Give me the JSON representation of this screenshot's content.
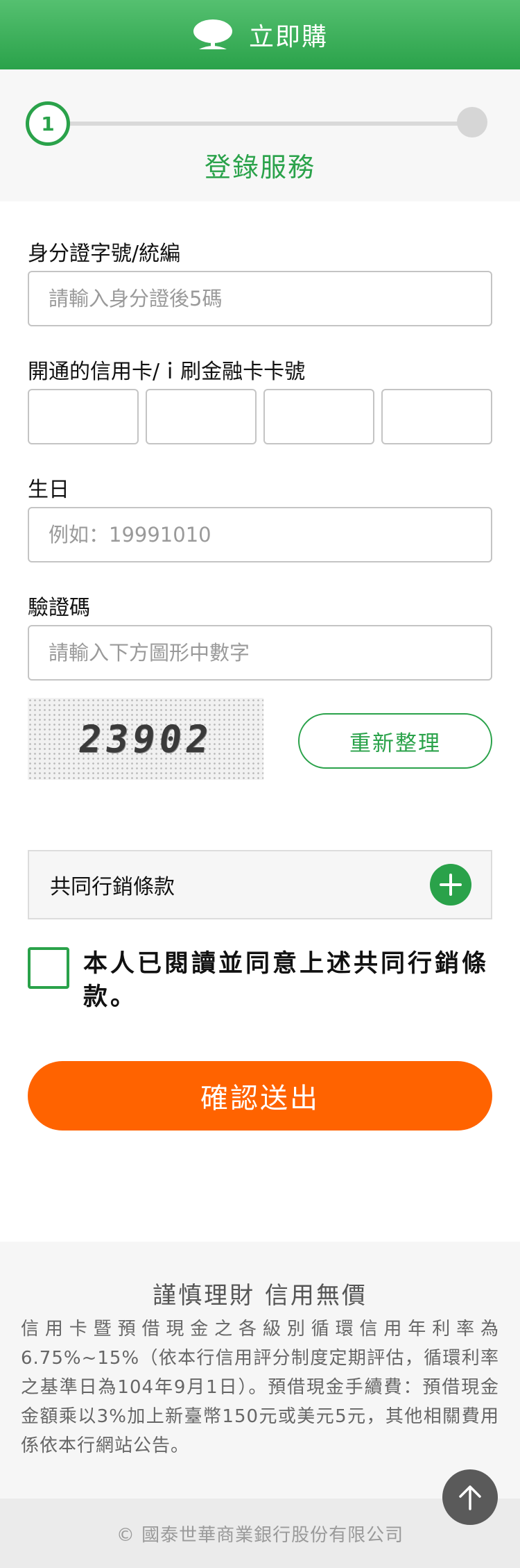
{
  "header": {
    "title": "立即購",
    "logo_icon": "tree-icon"
  },
  "stepper": {
    "current_step": "1",
    "label": "登錄服務"
  },
  "form": {
    "id_label": "身分證字號/統編",
    "id_placeholder": "請輸入身分證後5碼",
    "card_label": "開通的信用卡/ｉ刷金融卡卡號",
    "birthday_label": "生日",
    "birthday_placeholder": "例如：19991010",
    "captcha_label": "驗證碼",
    "captcha_placeholder": "請輸入下方圖形中數字",
    "captcha_text": "23902",
    "refresh_label": "重新整理"
  },
  "terms": {
    "label": "共同行銷條款",
    "expand_icon": "plus-icon"
  },
  "agreement": {
    "text": "本人已閱讀並同意上述共同行銷條款。",
    "checked": false
  },
  "submit_label": "確認送出",
  "disclaimer": {
    "title": "謹慎理財  信用無價",
    "body": "信用卡暨預借現金之各級別循環信用年利率為6.75%~15%（依本行信用評分制度定期評估，循環利率之基準日為104年9月1日）。預借現金手續費：預借現金金額乘以3%加上新臺幣150元或美元5元，其他相關費用係依本行網站公告。"
  },
  "footer": {
    "copyright": "© 國泰世華商業銀行股份有限公司"
  },
  "colors": {
    "brand_green": "#2aa24a",
    "submit_orange": "#ff6300"
  }
}
